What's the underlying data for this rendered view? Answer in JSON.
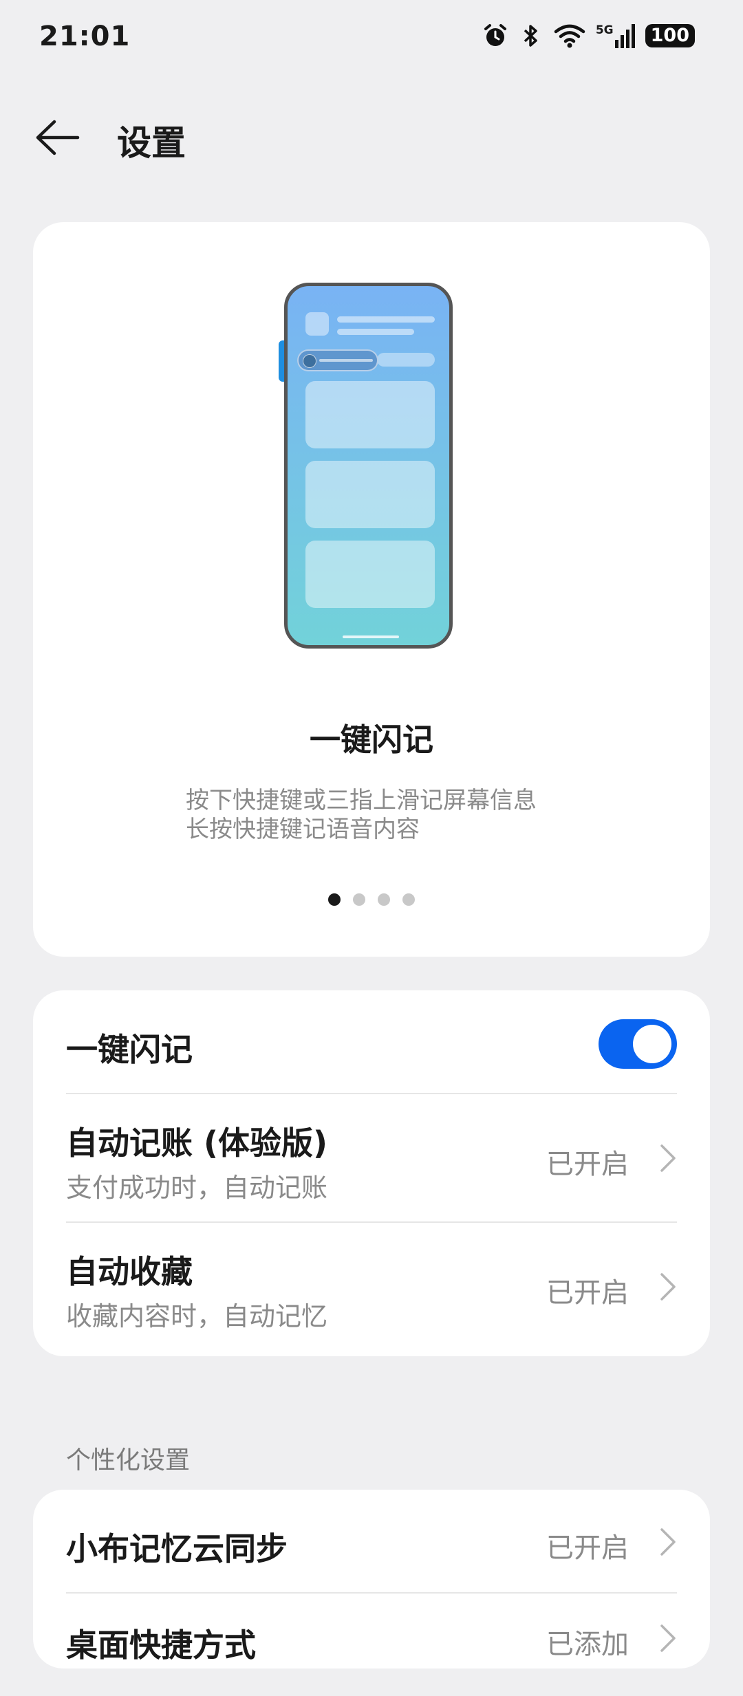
{
  "status_bar": {
    "time": "21:01",
    "signal_label": "5G",
    "battery": "100"
  },
  "header": {
    "title": "设置"
  },
  "hero": {
    "title": "一键闪记",
    "desc_line1": "按下快捷键或三指上滑记屏幕信息",
    "desc_line2": "长按快捷键记语音内容",
    "page_count": 4,
    "active_page": 1
  },
  "settings": {
    "quick_note": {
      "label": "一键闪记",
      "enabled": true
    },
    "auto_bookkeeping": {
      "label": "自动记账 (体验版)",
      "subtitle": "支付成功时，自动记账",
      "value": "已开启"
    },
    "auto_favorite": {
      "label": "自动收藏",
      "subtitle": "收藏内容时，自动记忆",
      "value": "已开启"
    }
  },
  "personal": {
    "section_label": "个性化设置",
    "cloud_sync": {
      "label": "小布记忆云同步",
      "value": "已开启"
    },
    "desktop_shortcut": {
      "label": "桌面快捷方式",
      "value": "已添加"
    }
  },
  "colors": {
    "accent": "#0a64f0",
    "background": "#efeff1"
  }
}
